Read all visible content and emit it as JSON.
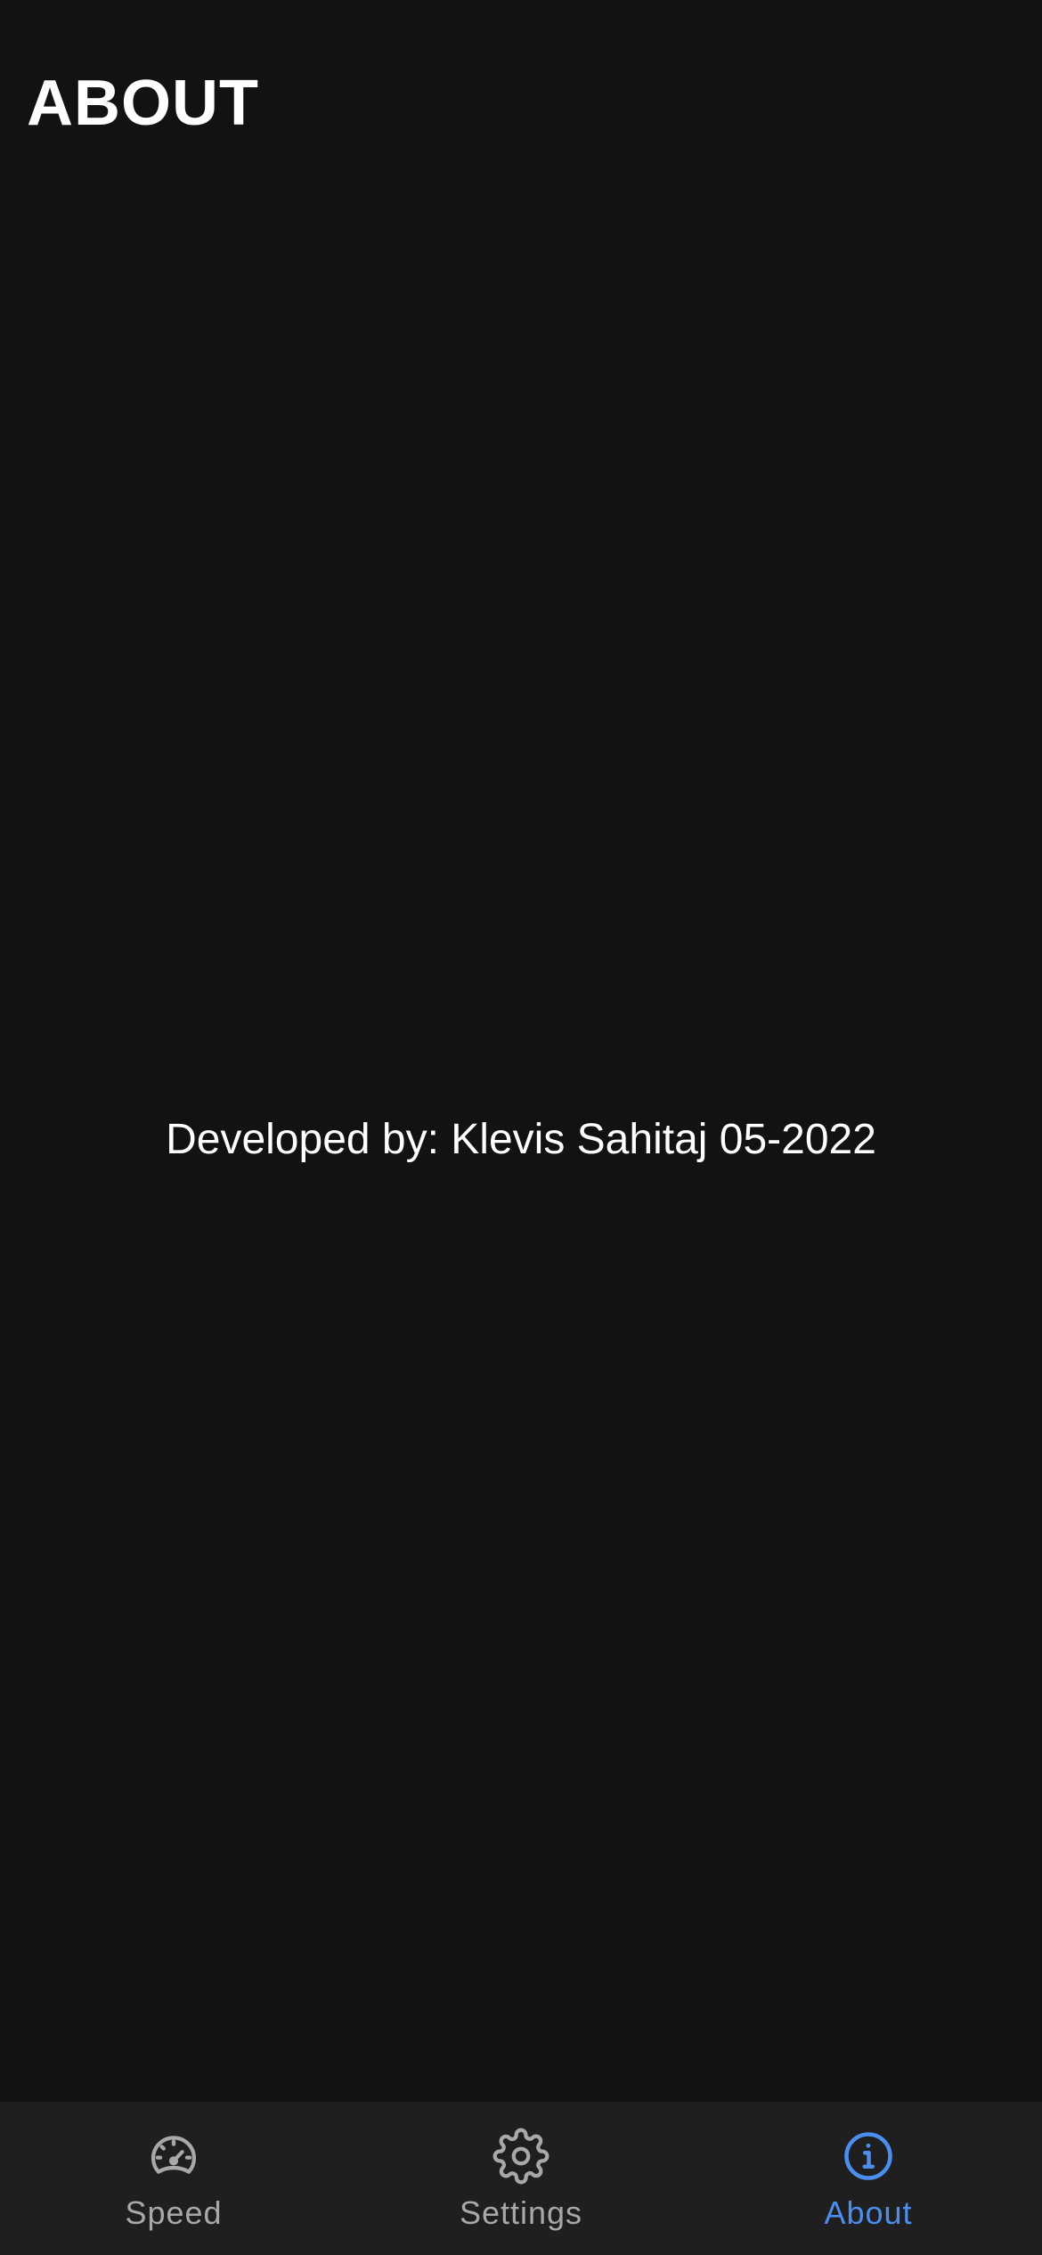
{
  "header": {
    "title": "ABOUT"
  },
  "main": {
    "credit_text": "Developed by: Klevis Sahitaj 05-2022"
  },
  "bottom_nav": {
    "items": [
      {
        "label": "Speed",
        "icon": "speedometer-icon",
        "active": false
      },
      {
        "label": "Settings",
        "icon": "gear-icon",
        "active": false
      },
      {
        "label": "About",
        "icon": "info-icon",
        "active": true
      }
    ]
  },
  "colors": {
    "background": "#121212",
    "nav_background": "#1f1f1f",
    "inactive": "#a8a8a8",
    "accent": "#4a8ef0",
    "text": "#ffffff"
  }
}
